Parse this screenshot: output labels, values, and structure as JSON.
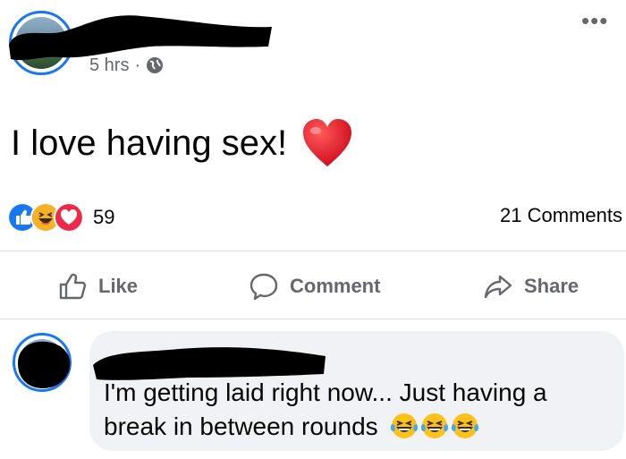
{
  "post": {
    "time": "5 hrs",
    "separator": "·",
    "text": "I love having sex!",
    "more_label": "•••"
  },
  "reactions": {
    "count": "59",
    "comments": "21 Comments",
    "types": [
      "like-icon",
      "haha-icon",
      "love-icon"
    ]
  },
  "actions": {
    "like": "Like",
    "comment": "Comment",
    "share": "Share"
  },
  "comment": {
    "text": "I'm getting laid right now... Just having a break in between rounds",
    "emojis": [
      "laughing-tears-icon",
      "laughing-tears-icon",
      "laughing-tears-icon"
    ]
  },
  "colors": {
    "accent": "#1877f2",
    "secondary_text": "#65676b",
    "bubble": "#f0f2f5",
    "redaction": "#000000"
  }
}
